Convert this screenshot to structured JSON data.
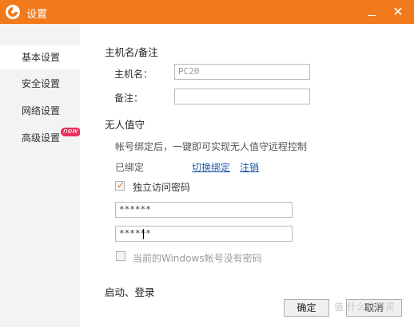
{
  "window": {
    "title": "设置"
  },
  "sidebar": {
    "items": [
      {
        "label": "基本设置",
        "active": true
      },
      {
        "label": "安全设置",
        "active": false
      },
      {
        "label": "网络设置",
        "active": false
      },
      {
        "label": "高级设置",
        "active": false,
        "badge": "new"
      }
    ]
  },
  "host_section": {
    "title": "主机名/备注",
    "hostname_label": "主机名：",
    "hostname_value": "PC20",
    "note_label": "备注：",
    "note_value": ""
  },
  "unattended": {
    "title": "无人值守",
    "description": "帐号绑定后，一键即可实现无人值守远程控制",
    "bound_status": "已绑定",
    "switch_link": "切换绑定",
    "logout_link": "注销",
    "independent_password_label": "独立访问密码",
    "independent_password_checked": true,
    "password_value": "******",
    "confirm_password_value": "******",
    "no_windows_password_label": "当前的Windows帐号没有密码",
    "no_windows_password_checked": false
  },
  "startup_section": {
    "title": "启动、登录"
  },
  "footer": {
    "ok_label": "确定",
    "cancel_label": "取消"
  },
  "watermark": "值 什么值得买",
  "colors": {
    "titlebar": "#f07a1c",
    "badge": "#e8305a",
    "link": "#1e5aa8"
  }
}
